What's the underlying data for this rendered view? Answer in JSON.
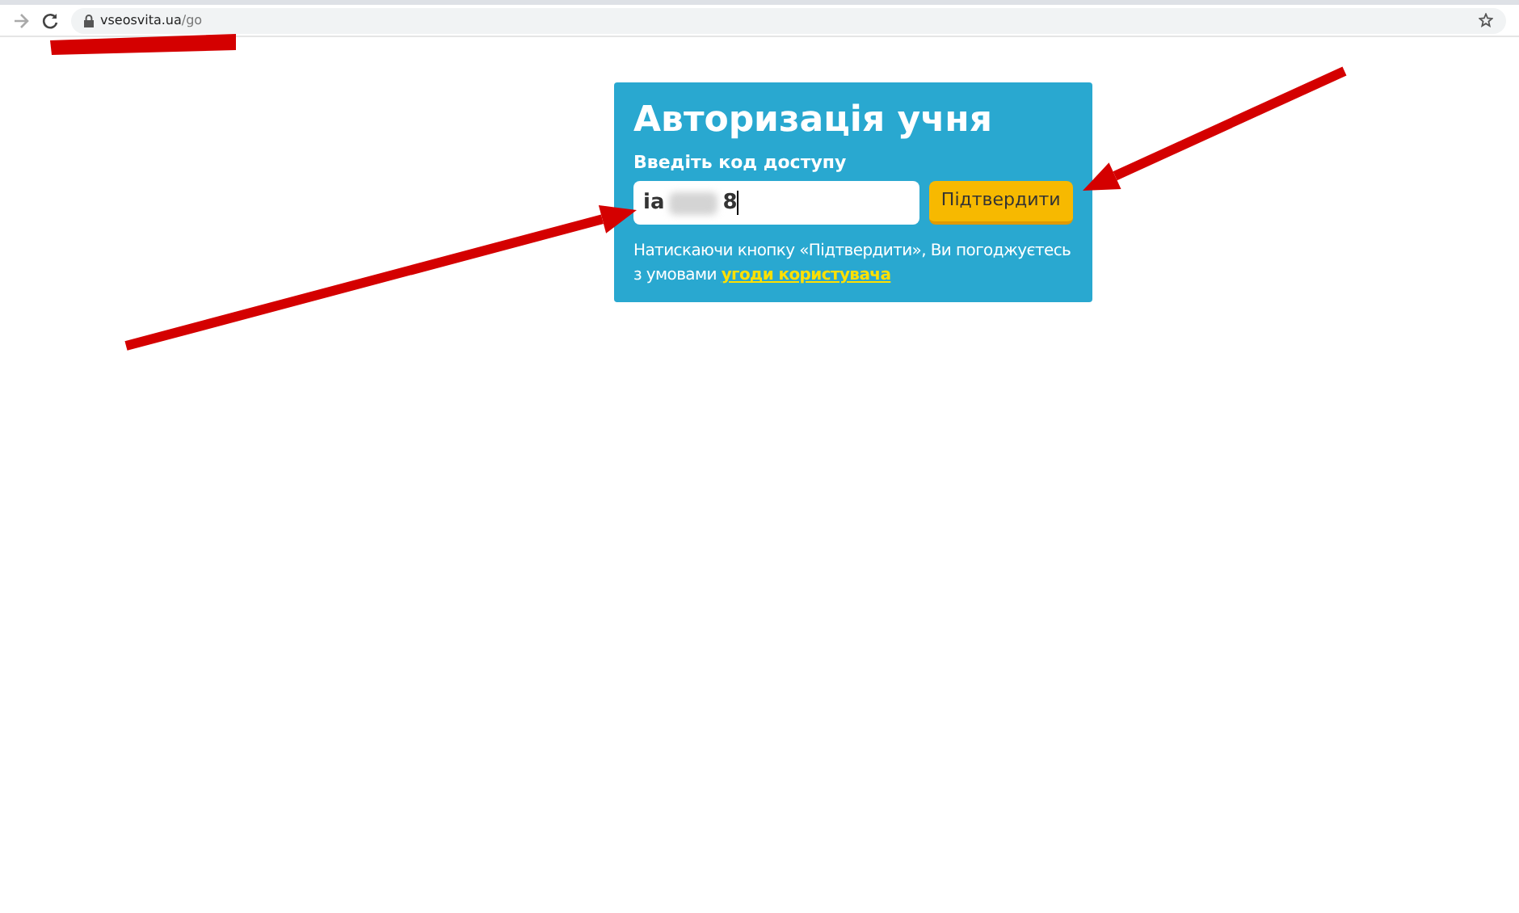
{
  "browser": {
    "url_host": "vseosvita.ua",
    "url_path": "/go"
  },
  "card": {
    "title": "Авторизація учня",
    "field_label": "Введіть код доступу",
    "field": {
      "value_start": "ia",
      "value_end": "8",
      "redacted": true
    },
    "submit_button": "Підтвердити",
    "notice": "Натискаючи кнопку «Підтвердити», Ви погоджуєтесь з умовами",
    "notice_link": "угоди користувача"
  },
  "annotations": [
    {
      "kind": "arrow"
    },
    {
      "kind": "arrow"
    },
    {
      "kind": "bar"
    }
  ]
}
